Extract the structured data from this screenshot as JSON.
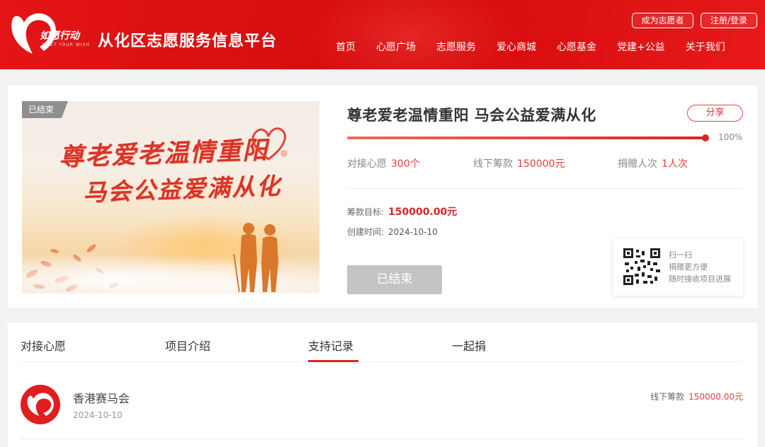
{
  "header": {
    "logo_text": "如愿行动",
    "logo_sub": "MEET YOUR WISH",
    "site_title": "从化区志愿服务信息平台",
    "volunteer_button": "成为志愿者",
    "login_button": "注册/登录",
    "nav": [
      "首页",
      "心愿广场",
      "志愿服务",
      "爱心商城",
      "心愿基金",
      "党建+公益",
      "关于我们"
    ]
  },
  "project": {
    "status_tag": "已结束",
    "banner_line1": "尊老爱老温情重阳",
    "banner_line2": "马会公益爱满从化",
    "title": "尊老爱老温情重阳 马会公益爱满从化",
    "share_label": "分享",
    "progress": 1.0,
    "progress_text": "100%",
    "stats": [
      {
        "label": "对接心愿",
        "value": "300个"
      },
      {
        "label": "线下筹款",
        "value": "150000元"
      },
      {
        "label": "捐赠人次",
        "value": "1人次"
      }
    ],
    "goal_label": "筹款目标:",
    "goal_value": "150000.00元",
    "created_label": "创建时间:",
    "created_value": "2024-10-10",
    "ended_button": "已结束",
    "qr_lines": [
      "扫一扫",
      "捐赠更方便",
      "随时接收项目进展"
    ]
  },
  "tabs": [
    "对接心愿",
    "项目介绍",
    "支持记录",
    "一起捐"
  ],
  "active_tab": "支持记录",
  "records": [
    {
      "name": "香港赛马会",
      "date": "2024-10-10",
      "amount_label": "线下筹款",
      "amount_value": "150000.00元"
    }
  ],
  "colors": {
    "brand_red": "#e41516",
    "accent_red": "#d9232a",
    "muted": "#888888"
  }
}
